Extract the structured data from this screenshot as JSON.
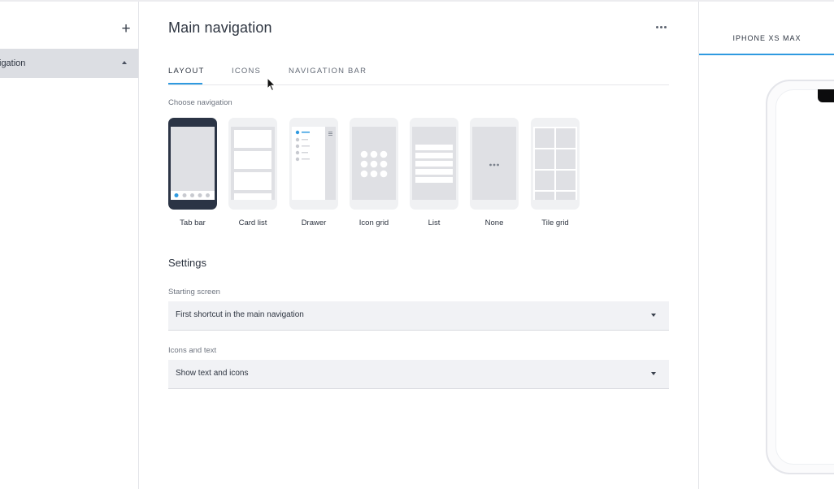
{
  "sidebar": {
    "add_symbol": "+",
    "active_item_label": "igation"
  },
  "main": {
    "title": "Main navigation",
    "tabs": [
      {
        "label": "LAYOUT",
        "active": true
      },
      {
        "label": "ICONS",
        "active": false
      },
      {
        "label": "NAVIGATION BAR",
        "active": false
      }
    ],
    "choose_label": "Choose navigation",
    "nav_options": [
      {
        "label": "Tab bar",
        "selected": true
      },
      {
        "label": "Card list",
        "selected": false
      },
      {
        "label": "Drawer",
        "selected": false
      },
      {
        "label": "Icon grid",
        "selected": false
      },
      {
        "label": "List",
        "selected": false
      },
      {
        "label": "None",
        "selected": false
      },
      {
        "label": "Tile grid",
        "selected": false
      }
    ],
    "settings_title": "Settings",
    "starting_screen": {
      "label": "Starting screen",
      "value": "First shortcut in the main navigation"
    },
    "icons_and_text": {
      "label": "Icons and text",
      "value": "Show text and icons"
    }
  },
  "preview": {
    "device_tab": "IPHONE XS MAX"
  },
  "colors": {
    "accent": "#2f9ae0",
    "selected_option_bg": "#2b3445",
    "option_bg": "#f0f1f3",
    "sidebar_active_bg": "#dcdee3"
  }
}
